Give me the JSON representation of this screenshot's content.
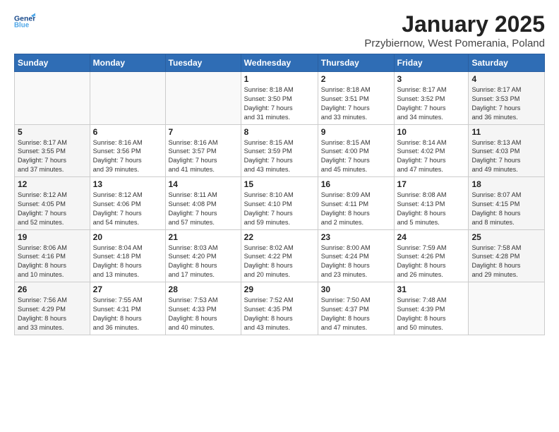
{
  "header": {
    "logo_line1": "General",
    "logo_line2": "Blue",
    "title": "January 2025",
    "subtitle": "Przybiernow, West Pomerania, Poland"
  },
  "weekdays": [
    "Sunday",
    "Monday",
    "Tuesday",
    "Wednesday",
    "Thursday",
    "Friday",
    "Saturday"
  ],
  "weeks": [
    [
      {
        "day": "",
        "info": ""
      },
      {
        "day": "",
        "info": ""
      },
      {
        "day": "",
        "info": ""
      },
      {
        "day": "1",
        "info": "Sunrise: 8:18 AM\nSunset: 3:50 PM\nDaylight: 7 hours\nand 31 minutes."
      },
      {
        "day": "2",
        "info": "Sunrise: 8:18 AM\nSunset: 3:51 PM\nDaylight: 7 hours\nand 33 minutes."
      },
      {
        "day": "3",
        "info": "Sunrise: 8:17 AM\nSunset: 3:52 PM\nDaylight: 7 hours\nand 34 minutes."
      },
      {
        "day": "4",
        "info": "Sunrise: 8:17 AM\nSunset: 3:53 PM\nDaylight: 7 hours\nand 36 minutes."
      }
    ],
    [
      {
        "day": "5",
        "info": "Sunrise: 8:17 AM\nSunset: 3:55 PM\nDaylight: 7 hours\nand 37 minutes."
      },
      {
        "day": "6",
        "info": "Sunrise: 8:16 AM\nSunset: 3:56 PM\nDaylight: 7 hours\nand 39 minutes."
      },
      {
        "day": "7",
        "info": "Sunrise: 8:16 AM\nSunset: 3:57 PM\nDaylight: 7 hours\nand 41 minutes."
      },
      {
        "day": "8",
        "info": "Sunrise: 8:15 AM\nSunset: 3:59 PM\nDaylight: 7 hours\nand 43 minutes."
      },
      {
        "day": "9",
        "info": "Sunrise: 8:15 AM\nSunset: 4:00 PM\nDaylight: 7 hours\nand 45 minutes."
      },
      {
        "day": "10",
        "info": "Sunrise: 8:14 AM\nSunset: 4:02 PM\nDaylight: 7 hours\nand 47 minutes."
      },
      {
        "day": "11",
        "info": "Sunrise: 8:13 AM\nSunset: 4:03 PM\nDaylight: 7 hours\nand 49 minutes."
      }
    ],
    [
      {
        "day": "12",
        "info": "Sunrise: 8:12 AM\nSunset: 4:05 PM\nDaylight: 7 hours\nand 52 minutes."
      },
      {
        "day": "13",
        "info": "Sunrise: 8:12 AM\nSunset: 4:06 PM\nDaylight: 7 hours\nand 54 minutes."
      },
      {
        "day": "14",
        "info": "Sunrise: 8:11 AM\nSunset: 4:08 PM\nDaylight: 7 hours\nand 57 minutes."
      },
      {
        "day": "15",
        "info": "Sunrise: 8:10 AM\nSunset: 4:10 PM\nDaylight: 7 hours\nand 59 minutes."
      },
      {
        "day": "16",
        "info": "Sunrise: 8:09 AM\nSunset: 4:11 PM\nDaylight: 8 hours\nand 2 minutes."
      },
      {
        "day": "17",
        "info": "Sunrise: 8:08 AM\nSunset: 4:13 PM\nDaylight: 8 hours\nand 5 minutes."
      },
      {
        "day": "18",
        "info": "Sunrise: 8:07 AM\nSunset: 4:15 PM\nDaylight: 8 hours\nand 8 minutes."
      }
    ],
    [
      {
        "day": "19",
        "info": "Sunrise: 8:06 AM\nSunset: 4:16 PM\nDaylight: 8 hours\nand 10 minutes."
      },
      {
        "day": "20",
        "info": "Sunrise: 8:04 AM\nSunset: 4:18 PM\nDaylight: 8 hours\nand 13 minutes."
      },
      {
        "day": "21",
        "info": "Sunrise: 8:03 AM\nSunset: 4:20 PM\nDaylight: 8 hours\nand 17 minutes."
      },
      {
        "day": "22",
        "info": "Sunrise: 8:02 AM\nSunset: 4:22 PM\nDaylight: 8 hours\nand 20 minutes."
      },
      {
        "day": "23",
        "info": "Sunrise: 8:00 AM\nSunset: 4:24 PM\nDaylight: 8 hours\nand 23 minutes."
      },
      {
        "day": "24",
        "info": "Sunrise: 7:59 AM\nSunset: 4:26 PM\nDaylight: 8 hours\nand 26 minutes."
      },
      {
        "day": "25",
        "info": "Sunrise: 7:58 AM\nSunset: 4:28 PM\nDaylight: 8 hours\nand 29 minutes."
      }
    ],
    [
      {
        "day": "26",
        "info": "Sunrise: 7:56 AM\nSunset: 4:29 PM\nDaylight: 8 hours\nand 33 minutes."
      },
      {
        "day": "27",
        "info": "Sunrise: 7:55 AM\nSunset: 4:31 PM\nDaylight: 8 hours\nand 36 minutes."
      },
      {
        "day": "28",
        "info": "Sunrise: 7:53 AM\nSunset: 4:33 PM\nDaylight: 8 hours\nand 40 minutes."
      },
      {
        "day": "29",
        "info": "Sunrise: 7:52 AM\nSunset: 4:35 PM\nDaylight: 8 hours\nand 43 minutes."
      },
      {
        "day": "30",
        "info": "Sunrise: 7:50 AM\nSunset: 4:37 PM\nDaylight: 8 hours\nand 47 minutes."
      },
      {
        "day": "31",
        "info": "Sunrise: 7:48 AM\nSunset: 4:39 PM\nDaylight: 8 hours\nand 50 minutes."
      },
      {
        "day": "",
        "info": ""
      }
    ]
  ]
}
